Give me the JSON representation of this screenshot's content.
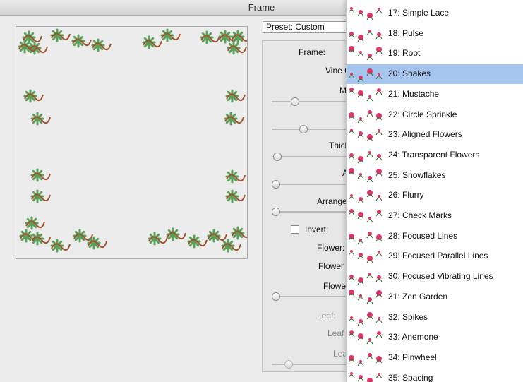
{
  "window": {
    "title": "Frame"
  },
  "preset": {
    "value": "Preset: Custom"
  },
  "panel": {
    "frame_label": "Frame:",
    "vine_label": "Vine C",
    "m_label": "M",
    "thickness_label": "Thick",
    "a_label": "A",
    "arrange_label": "Arrange",
    "invert_label": "Invert:",
    "flower_label": "Flower:",
    "flower_c_label": "Flower C",
    "flower_s_label": "Flower",
    "leaf_label": "Leaf:",
    "leaf_c_label": "Leaf C",
    "leaf_s_label": "Leaf"
  },
  "sliders": [
    {
      "id": "slider-1",
      "value": 0.27
    },
    {
      "id": "slider-2",
      "value": 0.39
    },
    {
      "id": "slider-3",
      "value": 0.02
    },
    {
      "id": "slider-4",
      "value": 0.0
    },
    {
      "id": "slider-5",
      "value": 0.0
    },
    {
      "id": "slider-6",
      "value": 0.0
    },
    {
      "id": "slider-7",
      "value": 0.18
    }
  ],
  "frame_list": [
    {
      "label": "17: Simple Lace"
    },
    {
      "label": "18: Pulse"
    },
    {
      "label": "19: Root"
    },
    {
      "label": "20: Snakes",
      "selected": true
    },
    {
      "label": "21: Mustache"
    },
    {
      "label": "22: Circle Sprinkle"
    },
    {
      "label": "23: Aligned Flowers"
    },
    {
      "label": "24: Transparent Flowers"
    },
    {
      "label": "25: Snowflakes"
    },
    {
      "label": "26: Flurry"
    },
    {
      "label": "27: Check Marks"
    },
    {
      "label": "28: Focused Lines"
    },
    {
      "label": "29: Focused Parallel Lines"
    },
    {
      "label": "30: Focused Vibrating Lines"
    },
    {
      "label": "31: Zen Garden"
    },
    {
      "label": "32: Spikes"
    },
    {
      "label": "33: Anemone"
    },
    {
      "label": "34: Pinwheel"
    },
    {
      "label": "35: Spacing"
    }
  ],
  "colors": {
    "vine": "#a0522d",
    "flower": "#5aa05a",
    "accent": "#e0356a",
    "selection": "#a6c5ee"
  },
  "icons": {
    "invert_checkbox": "checkbox-icon"
  }
}
